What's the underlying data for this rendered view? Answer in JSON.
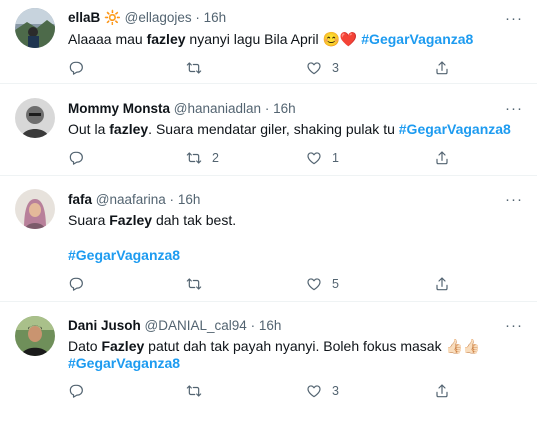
{
  "tweets": [
    {
      "name": "ellaB",
      "name_emoji": "🔆",
      "handle": "@ellagojes",
      "dot": "·",
      "time": "16h",
      "line1": {
        "pre": "Alaaaa mau ",
        "bold": "fazley",
        "post": " nyanyi lagu Bila April ",
        "emoji": "😊❤️",
        "tag": "#GegarVaganza8"
      },
      "reply_count": "",
      "retweet_count": "",
      "like_count": "3"
    },
    {
      "name": "Mommy Monsta",
      "handle": "@hananiadlan",
      "dot": "·",
      "time": "16h",
      "line1": {
        "pre": "Out la ",
        "bold": "fazley",
        "post": ". Suara mendatar giler, shaking pulak tu ",
        "tag": "#GegarVaganza8"
      },
      "reply_count": "",
      "retweet_count": "2",
      "like_count": "1"
    },
    {
      "name": "fafa",
      "handle": "@naafarina",
      "dot": "·",
      "time": "16h",
      "line1": {
        "pre": "Suara ",
        "bold": "Fazley",
        "post": " dah tak best."
      },
      "line2": {
        "tag": "#GegarVaganza8"
      },
      "reply_count": "",
      "retweet_count": "",
      "like_count": "5"
    },
    {
      "name": "Dani Jusoh",
      "handle": "@DANIAL_cal94",
      "dot": "·",
      "time": "16h",
      "line1": {
        "pre": "Dato ",
        "bold": "Fazley",
        "post": " patut dah tak payah nyanyi. Boleh fokus masak ",
        "emoji": "👍🏻👍🏻"
      },
      "line2": {
        "tag": "#GegarVaganza8"
      },
      "reply_count": "",
      "retweet_count": "",
      "like_count": "3"
    }
  ],
  "more_glyph": "···",
  "icons": [
    "reply-icon",
    "retweet-icon",
    "like-icon",
    "share-icon",
    "more-icon"
  ],
  "colors": {
    "hashtag": "#1d9bf0",
    "meta": "#536471",
    "text": "#0f1419",
    "divider": "#eff3f4"
  }
}
